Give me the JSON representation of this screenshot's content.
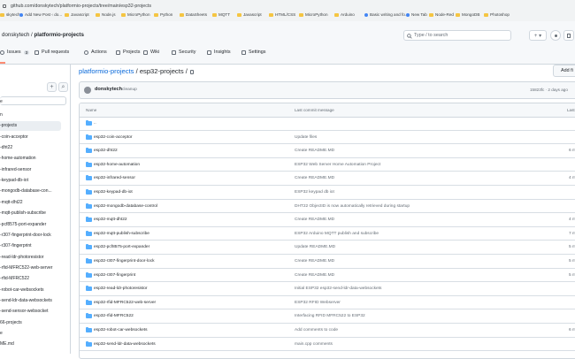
{
  "browser": {
    "url": "github.com/donskytech/platformio-projects/tree/main/esp32-projects",
    "bookmarks": [
      {
        "label": "skytech...",
        "icon": "folder-icon"
      },
      {
        "label": "Add New Post ‹ do...",
        "icon": "wordpress-icon"
      },
      {
        "label": "Javascript",
        "icon": "folder-icon"
      },
      {
        "label": "Node.js",
        "icon": "folder-icon"
      },
      {
        "label": "MicroPython",
        "icon": "folder-icon"
      },
      {
        "label": "Python",
        "icon": "folder-icon"
      },
      {
        "label": "DataSheets",
        "icon": "folder-icon"
      },
      {
        "label": "MQTT",
        "icon": "folder-icon"
      },
      {
        "label": "Javascript",
        "icon": "folder-icon"
      },
      {
        "label": "HTML/CSS",
        "icon": "folder-icon"
      },
      {
        "label": "MicroPython",
        "icon": "folder-icon"
      },
      {
        "label": "Arduino",
        "icon": "folder-icon"
      },
      {
        "label": "Basic writing and fo...",
        "icon": "github-icon"
      },
      {
        "label": "New Tab",
        "icon": "globe-icon"
      },
      {
        "label": "Node-Red",
        "icon": "folder-icon"
      },
      {
        "label": "MongoDB",
        "icon": "folder-icon"
      },
      {
        "label": "Photoshop",
        "icon": "folder-icon"
      }
    ]
  },
  "header": {
    "owner": "donskytech",
    "separator": "/",
    "repo": "platformio-projects",
    "search_placeholder": "Type / to search",
    "plus_label": "+ ▾",
    "colors": {
      "accent": "#0969da",
      "tab_underline": "#fd8c73",
      "folder": "#54aeff"
    }
  },
  "repo_nav": {
    "tabs": [
      {
        "label": "Issues",
        "count": "3"
      },
      {
        "label": "Pull requests"
      },
      {
        "label": "Actions"
      },
      {
        "label": "Projects"
      },
      {
        "label": "Wiki"
      },
      {
        "label": "Security"
      },
      {
        "label": "Insights"
      },
      {
        "label": "Settings"
      }
    ]
  },
  "sidebar": {
    "add_label": "+",
    "search_label": "⌕",
    "filter_text": "e",
    "items": [
      {
        "label": "n",
        "selected": false
      },
      {
        "label": "-projects",
        "selected": true
      },
      {
        "label": "-coin-acceptor",
        "selected": false
      },
      {
        "label": "-dht22",
        "selected": false
      },
      {
        "label": "-home-automation",
        "selected": false
      },
      {
        "label": "-infrared-sensor",
        "selected": false
      },
      {
        "label": "-keypad-db-iot",
        "selected": false
      },
      {
        "label": "-mongodb-database-con...",
        "selected": false
      },
      {
        "label": "-mqtt-dht22",
        "selected": false
      },
      {
        "label": "-mqtt-publish-subscribe",
        "selected": false
      },
      {
        "label": "-pcf8575-port-expander",
        "selected": false
      },
      {
        "label": "-r307-fingerprint-door-lock",
        "selected": false
      },
      {
        "label": "-r307-fingerprint",
        "selected": false
      },
      {
        "label": "-read-ldr-photoresistor",
        "selected": false
      },
      {
        "label": "-rfid-MFRC522-web-server",
        "selected": false
      },
      {
        "label": "-rfid-MFRC522",
        "selected": false
      },
      {
        "label": "-robot-car-websockets",
        "selected": false
      },
      {
        "label": "-send-ldr-data-websockets",
        "selected": false
      },
      {
        "label": "-send-sensor-websocket",
        "selected": false
      },
      {
        "label": "66-projects",
        "selected": false
      },
      {
        "label": "e",
        "selected": false
      },
      {
        "label": "ME.md",
        "selected": false
      }
    ]
  },
  "main": {
    "path_repo": "platformio-projects",
    "path_sep": " / ",
    "path_folder": "esp32-projects",
    "path_trailing": " /",
    "add_file_label": "Add fi",
    "latest_commit": {
      "author": "donskytech",
      "message": "cleanup",
      "meta": "15823fc · 2 days ago"
    },
    "table": {
      "col_name": "Name",
      "col_message": "Last commit message",
      "col_date": "Last",
      "parent_dir": "..",
      "rows": [
        {
          "name": "esp32-coin-acceptor",
          "message": "Update files",
          "date": ""
        },
        {
          "name": "esp32-dht22",
          "message": "Create README.MD",
          "date": "6 m"
        },
        {
          "name": "esp32-home-automation",
          "message": "ESP32 Web Server Home Automation Project",
          "date": ""
        },
        {
          "name": "esp32-infrared-sensor",
          "message": "Create README.MD",
          "date": "4 m"
        },
        {
          "name": "esp32-keypad-db-iot",
          "message": "ESP32 keypad db iot",
          "date": ""
        },
        {
          "name": "esp32-mongodb-database-control",
          "message": "DHT22 ObjectID is now automatically retrieved during startup",
          "date": ""
        },
        {
          "name": "esp32-mqtt-dht22",
          "message": "Create README.MD",
          "date": "4 m"
        },
        {
          "name": "esp32-mqtt-publish-subscribe",
          "message": "ESP32 Arduino MQTT publish and subscribe",
          "date": "7 m"
        },
        {
          "name": "esp32-pcf8575-port-expander",
          "message": "Update README.MD",
          "date": "5 m"
        },
        {
          "name": "esp32-r307-fingerprint-door-lock",
          "message": "Create README.MD",
          "date": "5 m"
        },
        {
          "name": "esp32-r307-fingerprint",
          "message": "Create README.MD",
          "date": "5 m"
        },
        {
          "name": "esp32-read-ldr-photoresistor",
          "message": "Initial ESP32 esp32-send-ldr-data-websockets",
          "date": ""
        },
        {
          "name": "esp32-rfid-MFRC522-web-server",
          "message": "ESP32 RFID Webserver",
          "date": ""
        },
        {
          "name": "esp32-rfid-MFRC522",
          "message": "Interfacing RFID MFRC522 to ESP32",
          "date": ""
        },
        {
          "name": "esp32-robot-car-websockets",
          "message": "Add comments to code",
          "date": "6 m"
        },
        {
          "name": "esp32-send-ldr-data-websockets",
          "message": "main.cpp comments",
          "date": ""
        }
      ]
    }
  }
}
